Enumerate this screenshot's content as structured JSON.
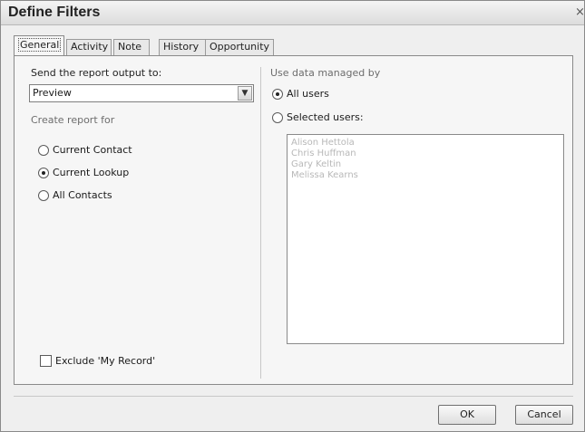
{
  "window": {
    "title": "Define Filters",
    "close_glyph": "×"
  },
  "tabs": [
    {
      "label": "General"
    },
    {
      "label": "Activity"
    },
    {
      "label": "Note"
    },
    {
      "label": "History"
    },
    {
      "label": "Opportunity"
    }
  ],
  "left": {
    "output_label": "Send the report output to:",
    "output_value": "Preview",
    "report_for_label": "Create report for",
    "options": [
      {
        "label": "Current Contact",
        "selected": false
      },
      {
        "label": "Current Lookup",
        "selected": true
      },
      {
        "label": "All Contacts",
        "selected": false
      }
    ],
    "exclude_label": "Exclude 'My Record'",
    "exclude_checked": false
  },
  "right": {
    "group_label": "Use data managed by",
    "all_users_label": "All users",
    "all_users_selected": true,
    "selected_users_label": "Selected users:",
    "selected_users_selected": false,
    "users": [
      "Alison Hettola",
      "Chris Huffman",
      "Gary Keltin",
      "Melissa Kearns"
    ]
  },
  "buttons": {
    "ok": "OK",
    "cancel": "Cancel"
  }
}
